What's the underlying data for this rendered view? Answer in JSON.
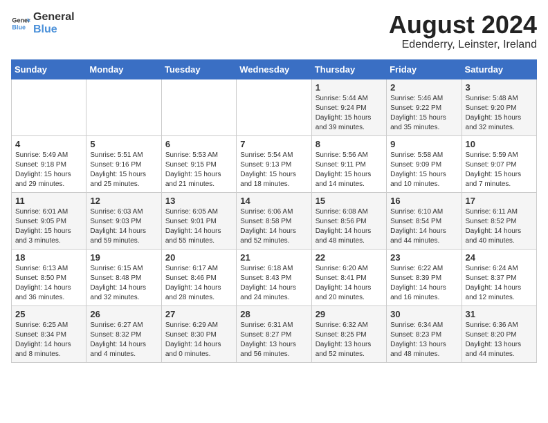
{
  "logo": {
    "general": "General",
    "blue": "Blue"
  },
  "title": {
    "month_year": "August 2024",
    "location": "Edenderry, Leinster, Ireland"
  },
  "headers": [
    "Sunday",
    "Monday",
    "Tuesday",
    "Wednesday",
    "Thursday",
    "Friday",
    "Saturday"
  ],
  "weeks": [
    [
      {
        "day": "",
        "info": ""
      },
      {
        "day": "",
        "info": ""
      },
      {
        "day": "",
        "info": ""
      },
      {
        "day": "",
        "info": ""
      },
      {
        "day": "1",
        "info": "Sunrise: 5:44 AM\nSunset: 9:24 PM\nDaylight: 15 hours\nand 39 minutes."
      },
      {
        "day": "2",
        "info": "Sunrise: 5:46 AM\nSunset: 9:22 PM\nDaylight: 15 hours\nand 35 minutes."
      },
      {
        "day": "3",
        "info": "Sunrise: 5:48 AM\nSunset: 9:20 PM\nDaylight: 15 hours\nand 32 minutes."
      }
    ],
    [
      {
        "day": "4",
        "info": "Sunrise: 5:49 AM\nSunset: 9:18 PM\nDaylight: 15 hours\nand 29 minutes."
      },
      {
        "day": "5",
        "info": "Sunrise: 5:51 AM\nSunset: 9:16 PM\nDaylight: 15 hours\nand 25 minutes."
      },
      {
        "day": "6",
        "info": "Sunrise: 5:53 AM\nSunset: 9:15 PM\nDaylight: 15 hours\nand 21 minutes."
      },
      {
        "day": "7",
        "info": "Sunrise: 5:54 AM\nSunset: 9:13 PM\nDaylight: 15 hours\nand 18 minutes."
      },
      {
        "day": "8",
        "info": "Sunrise: 5:56 AM\nSunset: 9:11 PM\nDaylight: 15 hours\nand 14 minutes."
      },
      {
        "day": "9",
        "info": "Sunrise: 5:58 AM\nSunset: 9:09 PM\nDaylight: 15 hours\nand 10 minutes."
      },
      {
        "day": "10",
        "info": "Sunrise: 5:59 AM\nSunset: 9:07 PM\nDaylight: 15 hours\nand 7 minutes."
      }
    ],
    [
      {
        "day": "11",
        "info": "Sunrise: 6:01 AM\nSunset: 9:05 PM\nDaylight: 15 hours\nand 3 minutes."
      },
      {
        "day": "12",
        "info": "Sunrise: 6:03 AM\nSunset: 9:03 PM\nDaylight: 14 hours\nand 59 minutes."
      },
      {
        "day": "13",
        "info": "Sunrise: 6:05 AM\nSunset: 9:01 PM\nDaylight: 14 hours\nand 55 minutes."
      },
      {
        "day": "14",
        "info": "Sunrise: 6:06 AM\nSunset: 8:58 PM\nDaylight: 14 hours\nand 52 minutes."
      },
      {
        "day": "15",
        "info": "Sunrise: 6:08 AM\nSunset: 8:56 PM\nDaylight: 14 hours\nand 48 minutes."
      },
      {
        "day": "16",
        "info": "Sunrise: 6:10 AM\nSunset: 8:54 PM\nDaylight: 14 hours\nand 44 minutes."
      },
      {
        "day": "17",
        "info": "Sunrise: 6:11 AM\nSunset: 8:52 PM\nDaylight: 14 hours\nand 40 minutes."
      }
    ],
    [
      {
        "day": "18",
        "info": "Sunrise: 6:13 AM\nSunset: 8:50 PM\nDaylight: 14 hours\nand 36 minutes."
      },
      {
        "day": "19",
        "info": "Sunrise: 6:15 AM\nSunset: 8:48 PM\nDaylight: 14 hours\nand 32 minutes."
      },
      {
        "day": "20",
        "info": "Sunrise: 6:17 AM\nSunset: 8:46 PM\nDaylight: 14 hours\nand 28 minutes."
      },
      {
        "day": "21",
        "info": "Sunrise: 6:18 AM\nSunset: 8:43 PM\nDaylight: 14 hours\nand 24 minutes."
      },
      {
        "day": "22",
        "info": "Sunrise: 6:20 AM\nSunset: 8:41 PM\nDaylight: 14 hours\nand 20 minutes."
      },
      {
        "day": "23",
        "info": "Sunrise: 6:22 AM\nSunset: 8:39 PM\nDaylight: 14 hours\nand 16 minutes."
      },
      {
        "day": "24",
        "info": "Sunrise: 6:24 AM\nSunset: 8:37 PM\nDaylight: 14 hours\nand 12 minutes."
      }
    ],
    [
      {
        "day": "25",
        "info": "Sunrise: 6:25 AM\nSunset: 8:34 PM\nDaylight: 14 hours\nand 8 minutes."
      },
      {
        "day": "26",
        "info": "Sunrise: 6:27 AM\nSunset: 8:32 PM\nDaylight: 14 hours\nand 4 minutes."
      },
      {
        "day": "27",
        "info": "Sunrise: 6:29 AM\nSunset: 8:30 PM\nDaylight: 14 hours\nand 0 minutes."
      },
      {
        "day": "28",
        "info": "Sunrise: 6:31 AM\nSunset: 8:27 PM\nDaylight: 13 hours\nand 56 minutes."
      },
      {
        "day": "29",
        "info": "Sunrise: 6:32 AM\nSunset: 8:25 PM\nDaylight: 13 hours\nand 52 minutes."
      },
      {
        "day": "30",
        "info": "Sunrise: 6:34 AM\nSunset: 8:23 PM\nDaylight: 13 hours\nand 48 minutes."
      },
      {
        "day": "31",
        "info": "Sunrise: 6:36 AM\nSunset: 8:20 PM\nDaylight: 13 hours\nand 44 minutes."
      }
    ]
  ]
}
